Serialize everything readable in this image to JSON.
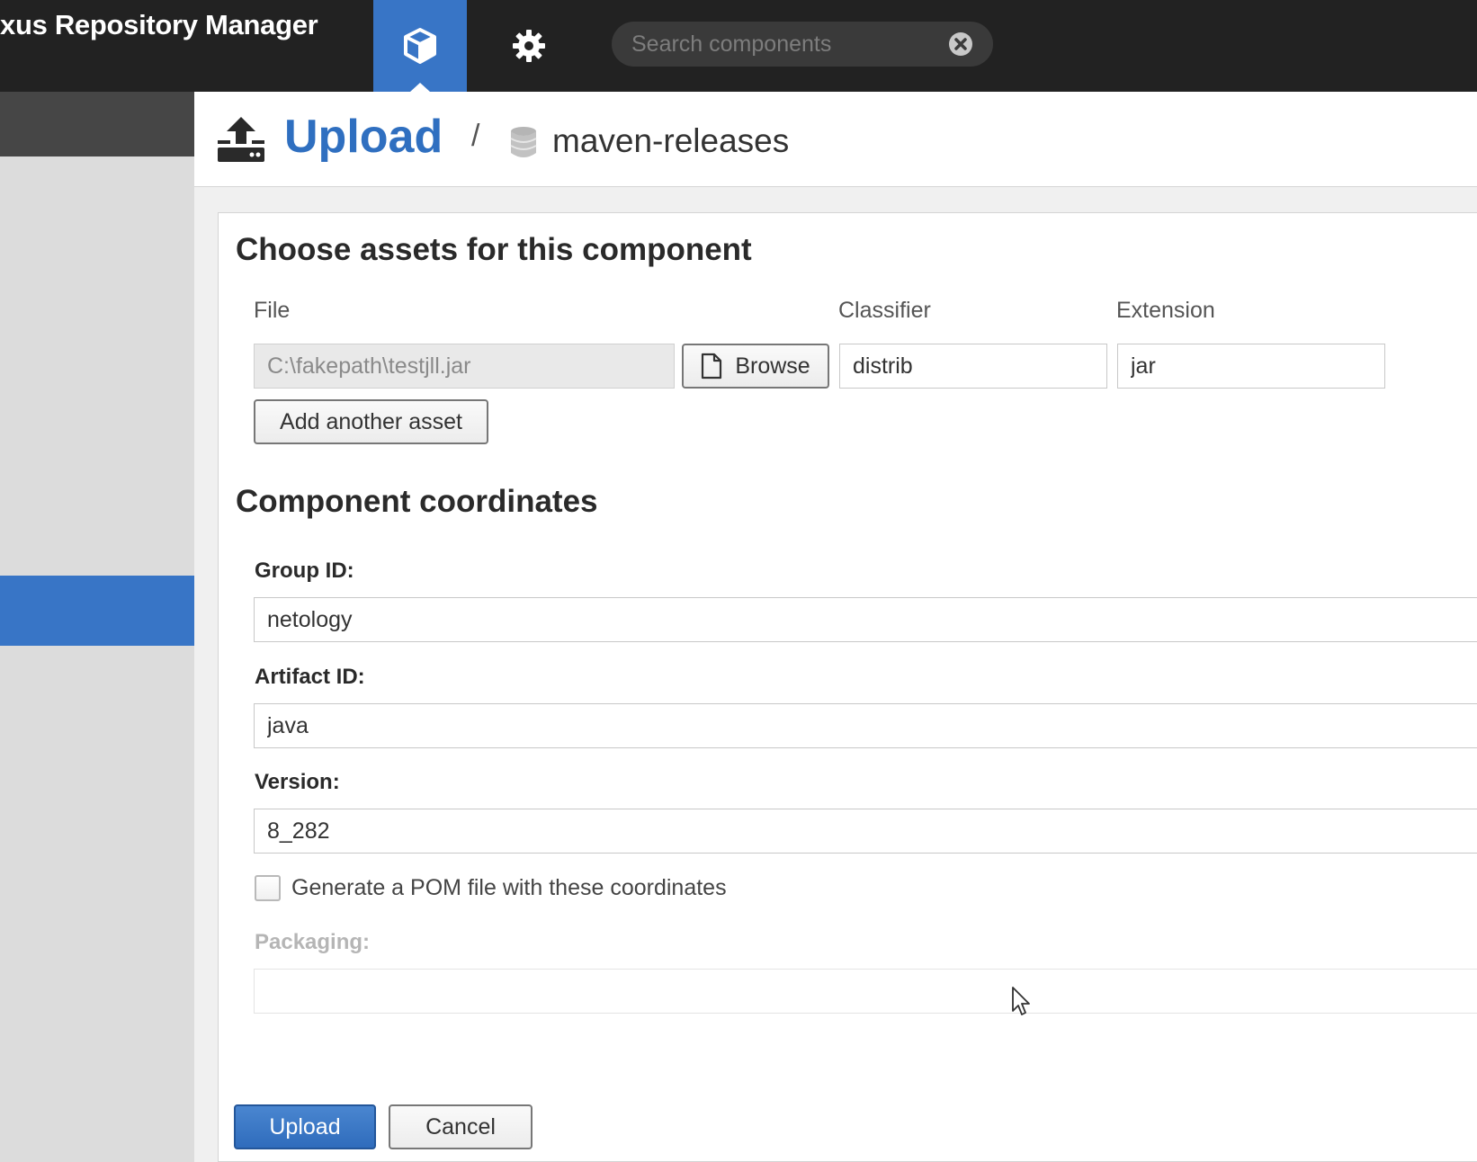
{
  "app": {
    "title": "xus Repository Manager"
  },
  "topbar": {
    "browse_icon": "cube-icon",
    "admin_icon": "gear-icon",
    "search": {
      "placeholder": "Search components",
      "value": "",
      "clear_icon": "clear-circle-icon"
    }
  },
  "header": {
    "icon": "upload-icon",
    "title": "Upload",
    "separator": "/",
    "repo_icon": "database-icon",
    "repo_name": "maven-releases"
  },
  "assets": {
    "heading": "Choose assets for this component",
    "columns": {
      "file": "File",
      "classifier": "Classifier",
      "extension": "Extension"
    },
    "row": {
      "file_value": "C:\\fakepath\\testjll.jar",
      "browse_label": "Browse",
      "browse_icon": "file-icon",
      "classifier_value": "distrib",
      "extension_value": "jar"
    },
    "add_asset_label": "Add another asset"
  },
  "coordinates": {
    "heading": "Component coordinates",
    "group_id_label": "Group ID:",
    "group_id_value": "netology",
    "artifact_id_label": "Artifact ID:",
    "artifact_id_value": "java",
    "version_label": "Version:",
    "version_value": "8_282",
    "generate_pom_label": "Generate a POM file with these coordinates",
    "generate_pom_checked": false,
    "packaging_label": "Packaging:",
    "packaging_value": ""
  },
  "actions": {
    "upload_label": "Upload",
    "cancel_label": "Cancel"
  },
  "colors": {
    "accent": "#3875c6",
    "topbar": "#222222",
    "title_blue": "#2f6fc0"
  }
}
